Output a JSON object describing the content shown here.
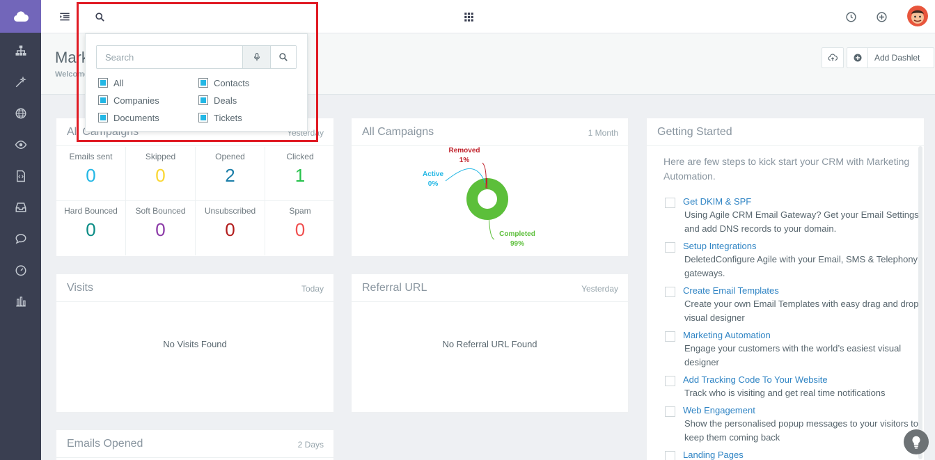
{
  "page": {
    "title": "Marketing",
    "subtitle": "Welcome"
  },
  "header_actions": {
    "add_dashlet": "Add Dashlet"
  },
  "search": {
    "placeholder": "Search",
    "options": [
      {
        "label": "All",
        "checked": true
      },
      {
        "label": "Contacts",
        "checked": true
      },
      {
        "label": "Companies",
        "checked": true
      },
      {
        "label": "Deals",
        "checked": true
      },
      {
        "label": "Documents",
        "checked": true
      },
      {
        "label": "Tickets",
        "checked": true
      }
    ]
  },
  "campaign_stats": {
    "title": "All Campaigns",
    "range": "Yesterday",
    "stats": [
      {
        "label": "Emails sent",
        "value": "0",
        "color": "#23b7e5"
      },
      {
        "label": "Skipped",
        "value": "0",
        "color": "#fad733"
      },
      {
        "label": "Opened",
        "value": "2",
        "color": "#1c7fa9"
      },
      {
        "label": "Clicked",
        "value": "1",
        "color": "#27c24c"
      },
      {
        "label": "Hard Bounced",
        "value": "0",
        "color": "#0a8c85"
      },
      {
        "label": "Soft Bounced",
        "value": "0",
        "color": "#8b3aa7"
      },
      {
        "label": "Unsubscribed",
        "value": "0",
        "color": "#b21c1c"
      },
      {
        "label": "Spam",
        "value": "0",
        "color": "#f05050"
      }
    ]
  },
  "campaign_chart": {
    "title": "All Campaigns",
    "range": "1 Month"
  },
  "chart_data": {
    "type": "pie",
    "title": "All Campaigns",
    "slices": [
      {
        "label": "Completed",
        "value": 99,
        "display": "99%",
        "color": "#5cbf3a"
      },
      {
        "label": "Active",
        "value": 0,
        "display": "0%",
        "color": "#23b7e5"
      },
      {
        "label": "Removed",
        "value": 1,
        "display": "1%",
        "color": "#c0202a"
      }
    ]
  },
  "visits": {
    "title": "Visits",
    "range": "Today",
    "empty": "No Visits Found"
  },
  "referral": {
    "title": "Referral URL",
    "range": "Yesterday",
    "empty": "No Referral URL Found"
  },
  "emails_opened": {
    "title": "Emails Opened",
    "range": "2 Days"
  },
  "getting_started": {
    "title": "Getting Started",
    "intro": "Here are few steps to kick start your CRM with Marketing Automation.",
    "items": [
      {
        "title": "Get DKIM & SPF",
        "desc": "Using Agile CRM Email Gateway? Get your Email Settings and add DNS records to your domain."
      },
      {
        "title": "Setup Integrations",
        "desc": "DeletedConfigure Agile with your Email, SMS & Telephony gateways."
      },
      {
        "title": "Create Email Templates",
        "desc": "Create your own Email Templates with easy drag and drop visual designer"
      },
      {
        "title": "Marketing Automation",
        "desc": "Engage your customers with the world’s easiest visual designer"
      },
      {
        "title": "Add Tracking Code To Your Website",
        "desc": "Track who is visiting and get real time notifications"
      },
      {
        "title": "Web Engagement",
        "desc": "Show the personalised popup messages to your visitors to keep them coming back"
      },
      {
        "title": "Landing Pages",
        "desc": ""
      }
    ]
  },
  "colors": {
    "sidebar": "#3a3f51",
    "brand": "#7266ba",
    "highlight": "#e01b24",
    "checkbox": "#23b7e5"
  },
  "icons": {
    "sidebar": [
      "cloud-icon",
      "sitemap-icon",
      "magic-wand-icon",
      "globe-icon",
      "eye-icon",
      "code-file-icon",
      "inbox-icon",
      "chat-icon",
      "gauge-icon",
      "bar-chart-icon"
    ],
    "topbar": [
      "menu-toggle-icon",
      "search-icon",
      "apps-grid-icon",
      "clock-icon",
      "plus-circle-icon",
      "avatar"
    ]
  }
}
